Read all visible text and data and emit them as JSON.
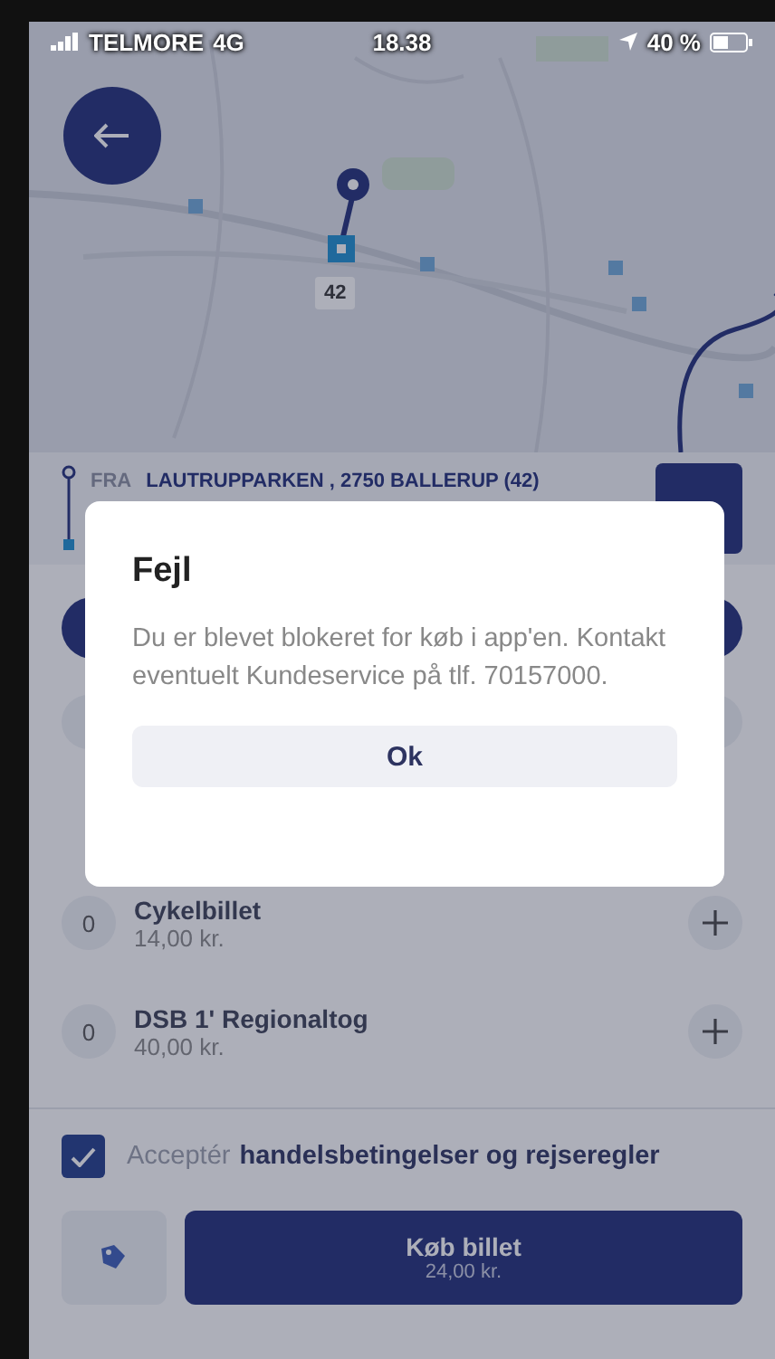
{
  "status_bar": {
    "carrier": "TELMORE",
    "network": "4G",
    "time": "18.38",
    "battery": "40 %"
  },
  "map": {
    "stop_label": "42"
  },
  "route": {
    "from_label": "FRA",
    "from": "LAUTRUPPARKEN , 2750 BALLERUP (42)"
  },
  "tickets": [
    {
      "count": "0",
      "name": "Cykelbillet",
      "price": "14,00 kr."
    },
    {
      "count": "0",
      "name": "DSB 1' Regionaltog",
      "price": "40,00 kr."
    }
  ],
  "terms": {
    "checked": true,
    "prefix": "Acceptér",
    "link": "handelsbetingelser og rejseregler"
  },
  "buy": {
    "label": "Køb billet",
    "price": "24,00 kr."
  },
  "dialog": {
    "title": "Fejl",
    "message": "Du er blevet blokeret for køb i app'en. Kontakt eventuelt Kundeservice på tlf. 70157000.",
    "button": "Ok"
  }
}
